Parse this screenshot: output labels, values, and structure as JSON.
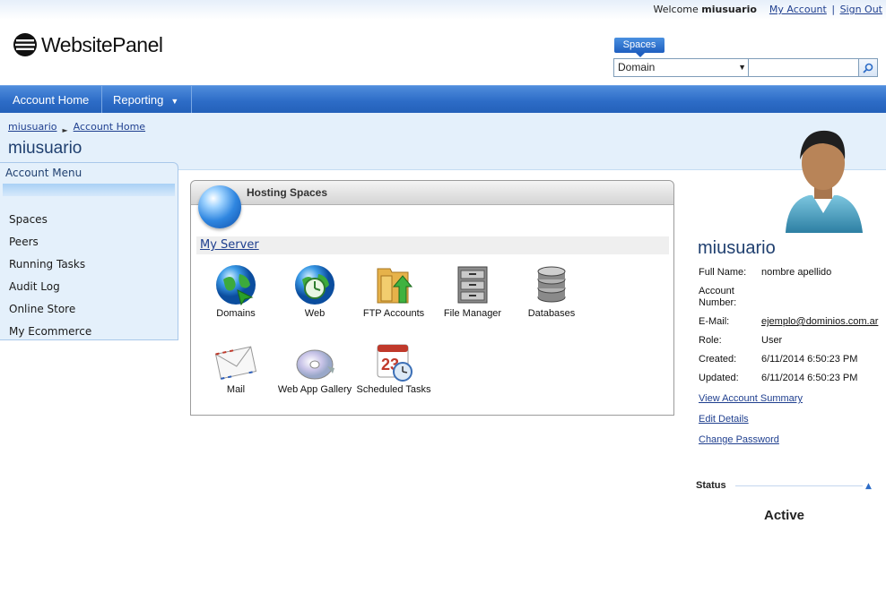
{
  "topbar": {
    "welcome": "Welcome",
    "username": "miusuario",
    "my_account": "My Account",
    "separator": "|",
    "sign_out": "Sign Out"
  },
  "logo": {
    "text": "WebsitePanel"
  },
  "search": {
    "tab_label": "Spaces",
    "select_value": "Domain",
    "input_value": ""
  },
  "nav": {
    "items": [
      {
        "label": "Account Home"
      },
      {
        "label": "Reporting"
      }
    ]
  },
  "breadcrumb": {
    "items": [
      "miusuario",
      "Account Home"
    ]
  },
  "page": {
    "title": "miusuario"
  },
  "account_menu": {
    "title": "Account Menu",
    "items": [
      "Spaces",
      "Peers",
      "Running Tasks",
      "Audit Log",
      "Online Store",
      "My Ecommerce"
    ]
  },
  "hosting": {
    "title": "Hosting Spaces",
    "server": "My Server",
    "tiles": [
      {
        "label": "Domains",
        "icon": "domains-icon"
      },
      {
        "label": "Web",
        "icon": "web-icon"
      },
      {
        "label": "FTP Accounts",
        "icon": "ftp-accounts-icon"
      },
      {
        "label": "File Manager",
        "icon": "file-manager-icon"
      },
      {
        "label": "Databases",
        "icon": "databases-icon"
      },
      {
        "label": "Mail",
        "icon": "mail-icon"
      },
      {
        "label": "Web App Gallery",
        "icon": "web-app-gallery-icon"
      },
      {
        "label": "Scheduled Tasks",
        "icon": "scheduled-tasks-icon"
      }
    ]
  },
  "profile": {
    "name": "miusuario",
    "full_name_label": "Full Name:",
    "full_name": "nombre apellido",
    "account_number_label": "Account Number:",
    "account_number": "",
    "email_label": "E-Mail:",
    "email": "ejemplo@dominios.com.ar",
    "role_label": "Role:",
    "role": "User",
    "created_label": "Created:",
    "created": "6/11/2014 6:50:23 PM",
    "updated_label": "Updated:",
    "updated": "6/11/2014 6:50:23 PM",
    "links": [
      "View Account Summary",
      "Edit Details",
      "Change Password"
    ]
  },
  "status": {
    "title": "Status",
    "value": "Active"
  },
  "colors": {
    "nav": "#2d6cc7",
    "band": "#e4f0fb",
    "link": "#1f3f8f"
  }
}
